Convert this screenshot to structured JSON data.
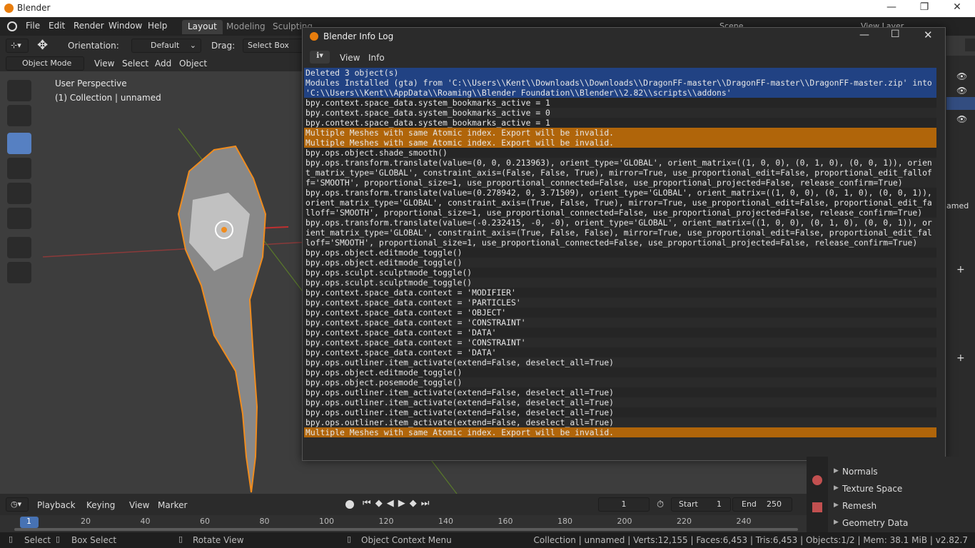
{
  "os": {
    "title": "Blender",
    "minimize": "—",
    "maximize": "❐",
    "close": "✕"
  },
  "topbar": {
    "menus": [
      "File",
      "Edit",
      "Render",
      "Window",
      "Help"
    ],
    "workspaces": [
      "Layout",
      "Modeling",
      "Sculpting"
    ],
    "scene": "Scene",
    "view_layer": "View Layer"
  },
  "toolheader": {
    "orientation_label": "Orientation:",
    "orientation_value": "Default",
    "drag_label": "Drag:",
    "drag_value": "Select Box"
  },
  "viewheader": {
    "mode": "Object Mode",
    "menus": [
      "View",
      "Select",
      "Add",
      "Object"
    ]
  },
  "viewport": {
    "perspective": "User Perspective",
    "collection": "(1) Collection | unnamed"
  },
  "infolog": {
    "title": "Blender Info Log",
    "menus": [
      "View",
      "Info"
    ],
    "lines": [
      {
        "text": "Deleted 3 object(s)",
        "kind": "sel"
      },
      {
        "text": "Modules Installed (gta) from 'C:\\\\Users\\\\Kent\\\\Downloads\\\\Downloads\\\\DragonFF-master\\\\DragonFF-master\\\\DragonFF-master.zip' into 'C:\\\\Users\\\\Kent\\\\AppData\\\\Roaming\\\\Blender Foundation\\\\Blender\\\\2.82\\\\scripts\\\\addons'",
        "kind": "sel"
      },
      {
        "text": "bpy.context.space_data.system_bookmarks_active = 1",
        "kind": "s"
      },
      {
        "text": "bpy.context.space_data.system_bookmarks_active = 0",
        "kind": "o"
      },
      {
        "text": "bpy.context.space_data.system_bookmarks_active = 1",
        "kind": "s"
      },
      {
        "text": "Multiple Meshes with same Atomic index. Export will be invalid.",
        "kind": "warn"
      },
      {
        "text": "Multiple Meshes with same Atomic index. Export will be invalid.",
        "kind": "warn"
      },
      {
        "text": "bpy.ops.object.shade_smooth()",
        "kind": "s"
      },
      {
        "text": "bpy.ops.transform.translate(value=(0, 0, 0.213963), orient_type='GLOBAL', orient_matrix=((1, 0, 0), (0, 1, 0), (0, 0, 1)), orient_matrix_type='GLOBAL', constraint_axis=(False, False, True), mirror=True, use_proportional_edit=False, proportional_edit_falloff='SMOOTH', proportional_size=1, use_proportional_connected=False, use_proportional_projected=False, release_confirm=True)",
        "kind": "o"
      },
      {
        "text": "bpy.ops.transform.translate(value=(0.278942, 0, 3.71509), orient_type='GLOBAL', orient_matrix=((1, 0, 0), (0, 1, 0), (0, 0, 1)), orient_matrix_type='GLOBAL', constraint_axis=(True, False, True), mirror=True, use_proportional_edit=False, proportional_edit_falloff='SMOOTH', proportional_size=1, use_proportional_connected=False, use_proportional_projected=False, release_confirm=True)",
        "kind": "s"
      },
      {
        "text": "bpy.ops.transform.translate(value=(-0.232415, -0, -0), orient_type='GLOBAL', orient_matrix=((1, 0, 0), (0, 1, 0), (0, 0, 1)), orient_matrix_type='GLOBAL', constraint_axis=(True, False, False), mirror=True, use_proportional_edit=False, proportional_edit_falloff='SMOOTH', proportional_size=1, use_proportional_connected=False, use_proportional_projected=False, release_confirm=True)",
        "kind": "o"
      },
      {
        "text": "bpy.ops.object.editmode_toggle()",
        "kind": "s"
      },
      {
        "text": "bpy.ops.object.editmode_toggle()",
        "kind": "o"
      },
      {
        "text": "bpy.ops.sculpt.sculptmode_toggle()",
        "kind": "s"
      },
      {
        "text": "bpy.ops.sculpt.sculptmode_toggle()",
        "kind": "o"
      },
      {
        "text": "bpy.context.space_data.context = 'MODIFIER'",
        "kind": "s"
      },
      {
        "text": "bpy.context.space_data.context = 'PARTICLES'",
        "kind": "o"
      },
      {
        "text": "bpy.context.space_data.context = 'OBJECT'",
        "kind": "s"
      },
      {
        "text": "bpy.context.space_data.context = 'CONSTRAINT'",
        "kind": "o"
      },
      {
        "text": "bpy.context.space_data.context = 'DATA'",
        "kind": "s"
      },
      {
        "text": "bpy.context.space_data.context = 'CONSTRAINT'",
        "kind": "o"
      },
      {
        "text": "bpy.context.space_data.context = 'DATA'",
        "kind": "s"
      },
      {
        "text": "bpy.ops.outliner.item_activate(extend=False, deselect_all=True)",
        "kind": "o"
      },
      {
        "text": "bpy.ops.object.editmode_toggle()",
        "kind": "s"
      },
      {
        "text": "bpy.ops.object.posemode_toggle()",
        "kind": "o"
      },
      {
        "text": "bpy.ops.outliner.item_activate(extend=False, deselect_all=True)",
        "kind": "s"
      },
      {
        "text": "bpy.ops.outliner.item_activate(extend=False, deselect_all=True)",
        "kind": "o"
      },
      {
        "text": "bpy.ops.outliner.item_activate(extend=False, deselect_all=True)",
        "kind": "s"
      },
      {
        "text": "bpy.ops.outliner.item_activate(extend=False, deselect_all=True)",
        "kind": "o"
      },
      {
        "text": "Multiple Meshes with same Atomic index. Export will be invalid.",
        "kind": "warn"
      }
    ]
  },
  "timeline": {
    "menus": [
      "Playback",
      "Keying",
      "View",
      "Marker"
    ],
    "current_frame": "1",
    "start_label": "Start",
    "start": "1",
    "end_label": "End",
    "end": "250",
    "ticks": [
      "1",
      "20",
      "40",
      "60",
      "80",
      "100",
      "120",
      "140",
      "160",
      "180",
      "200",
      "220",
      "240"
    ]
  },
  "props": {
    "partial_name": "amed",
    "items": [
      "Normals",
      "Texture Space",
      "Remesh",
      "Geometry Data"
    ]
  },
  "status": {
    "select": "Select",
    "box_select": "Box Select",
    "rotate": "Rotate View",
    "context_menu": "Object Context Menu",
    "stats": "Collection | unnamed | Verts:12,155 | Faces:6,453 | Tris:6,453 | Objects:1/2 | Mem: 38.1 MiB | v2.82.7"
  },
  "colors": {
    "accent": "#5680c2",
    "warning": "#b0650a",
    "selected": "#214283",
    "object_outline": "#f08c1e"
  }
}
